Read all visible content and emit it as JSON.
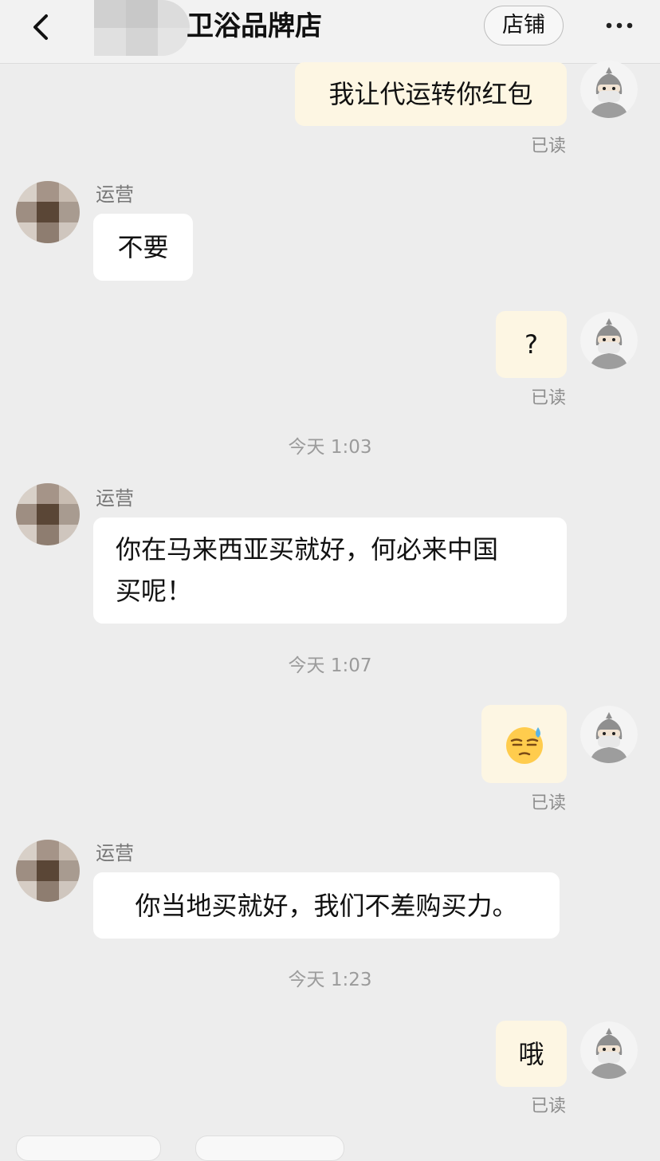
{
  "header": {
    "title": "卫浴品牌店",
    "store_button_label": "店铺"
  },
  "status_read_label": "已读",
  "messages": [
    {
      "sender": "me",
      "text": "我让代运转你红包",
      "status": "已读"
    },
    {
      "sender": "运营",
      "text": "不要"
    },
    {
      "sender": "me",
      "text": "?",
      "status": "已读"
    },
    {
      "timestamp": "今天 1:03"
    },
    {
      "sender": "运营",
      "lines": [
        "你在马来西亚买就好，何必来中国",
        "买呢！"
      ]
    },
    {
      "timestamp": "今天 1:07"
    },
    {
      "sender": "me",
      "emoji": "sweat-smile-emoji",
      "status": "已读"
    },
    {
      "sender": "运营",
      "text": "你当地买就好，我们不差购买力。"
    },
    {
      "timestamp": "今天 1:23"
    },
    {
      "sender": "me",
      "text": "哦",
      "status": "已读"
    }
  ],
  "colors": {
    "background": "#ededed",
    "my_bubble": "#fdf6e3",
    "their_bubble": "#ffffff"
  }
}
